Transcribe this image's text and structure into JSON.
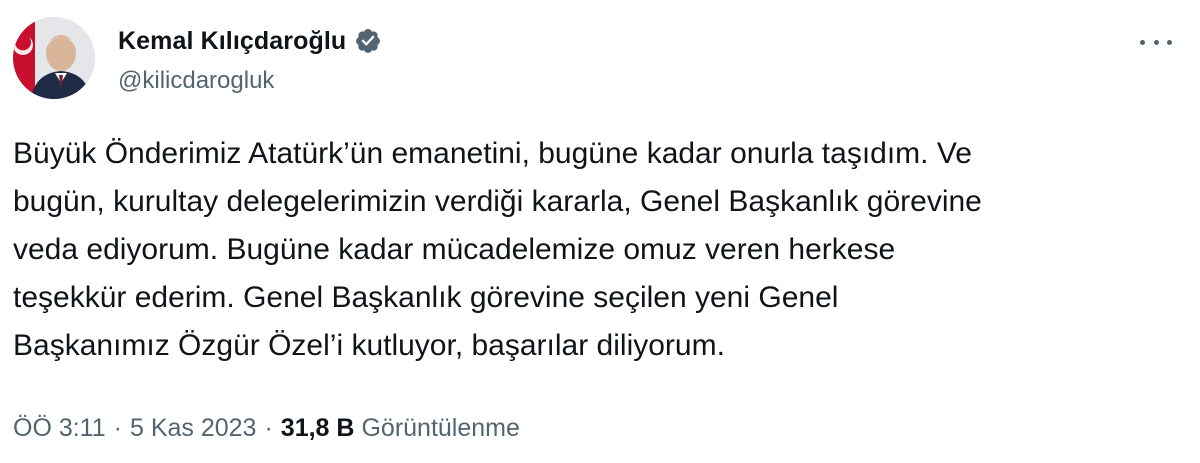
{
  "author": {
    "display_name": "Kemal Kılıçdaroğlu",
    "handle": "@kilicdarogluk",
    "verified_icon": "verified-badge-icon",
    "colors": {
      "verified": "#1d9bf0"
    }
  },
  "menu": {
    "icon": "more-horizontal-icon"
  },
  "tweet": {
    "lines": [
      "Büyük Önderimiz Atatürk’ün emanetini, bugüne kadar onurla taşıdım. Ve",
      "bugün, kurultay delegelerimizin verdiği kararla, Genel Başkanlık görevine",
      "veda ediyorum. Bugüne kadar mücadelemize omuz veren herkese",
      "teşekkür ederim. Genel Başkanlık görevine seçilen yeni Genel",
      "Başkanımız Özgür Özel’i kutluyor, başarılar diliyorum."
    ]
  },
  "meta": {
    "time": "ÖÖ 3:11",
    "separator": "·",
    "date": "5 Kas 2023",
    "views_count": "31,8 B",
    "views_label": "Görüntülenme"
  },
  "colors": {
    "text_primary": "#0f1419",
    "text_secondary": "#536471",
    "background": "#ffffff"
  }
}
